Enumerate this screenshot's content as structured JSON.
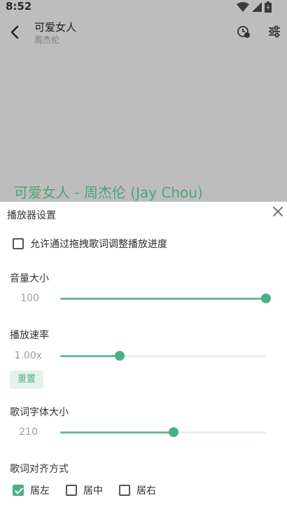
{
  "status": {
    "time": "8:52"
  },
  "appbar": {
    "title": "可爱女人",
    "subtitle": "周杰伦"
  },
  "lyric": "可爱女人 - 周杰伦 (Jay Chou)",
  "sheet": {
    "title": "播放器设置",
    "drag_lyric_label": "允许通过拖拽歌词调整播放进度",
    "drag_lyric_checked": false,
    "volume": {
      "label": "音量大小",
      "value": "100",
      "fraction": 1.0
    },
    "speed": {
      "label": "播放速率",
      "value": "1.00x",
      "fraction": 0.29,
      "reset_label": "重置"
    },
    "font_size": {
      "label": "歌词字体大小",
      "value": "210",
      "fraction": 0.55
    },
    "align": {
      "label": "歌词对齐方式",
      "options": [
        {
          "label": "居左",
          "checked": true
        },
        {
          "label": "居中",
          "checked": false
        },
        {
          "label": "居右",
          "checked": false
        }
      ]
    }
  },
  "colors": {
    "accent": "#4caf84",
    "lyric": "#4aa579",
    "scrim": "#bdbdbd"
  }
}
